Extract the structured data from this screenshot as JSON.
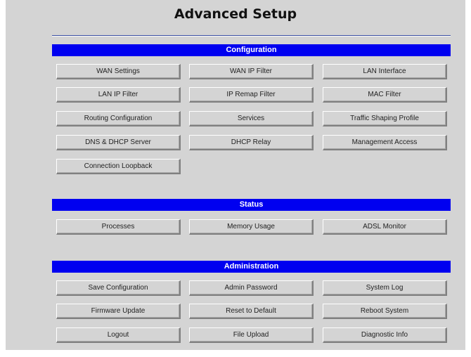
{
  "page": {
    "title": "Advanced Setup"
  },
  "configuration": {
    "header": "Configuration",
    "buttons": [
      "WAN Settings",
      "WAN IP Filter",
      "LAN Interface",
      "LAN IP Filter",
      "IP Remap Filter",
      "MAC Filter",
      "Routing Configuration",
      "Services",
      "Traffic Shaping Profile",
      "DNS & DHCP Server",
      "DHCP Relay",
      "Management Access",
      "Connection Loopback"
    ]
  },
  "status": {
    "header": "Status",
    "buttons": [
      "Processes",
      "Memory Usage",
      "ADSL Monitor"
    ]
  },
  "administration": {
    "header": "Administration",
    "buttons": [
      "Save Configuration",
      "Admin Password",
      "System Log",
      "Firmware Update",
      "Reset to Default",
      "Reboot System",
      "Logout",
      "File Upload",
      "Diagnostic Info"
    ]
  }
}
